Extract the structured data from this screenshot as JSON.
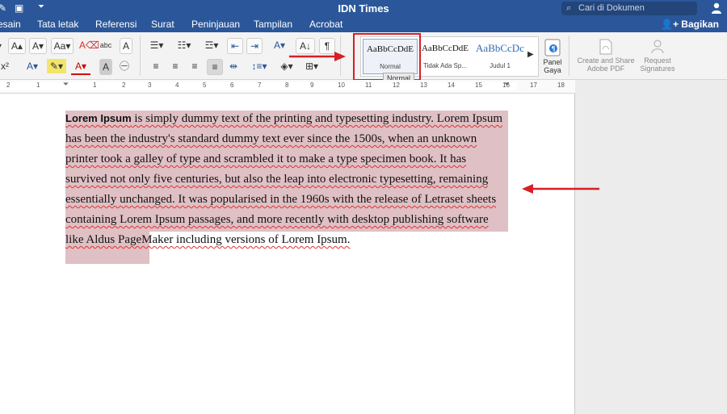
{
  "app": {
    "title": "IDN Times"
  },
  "search": {
    "placeholder": "Cari di Dokumen"
  },
  "tabs": [
    "esain",
    "Tata letak",
    "Referensi",
    "Surat",
    "Peninjauan",
    "Tampilan",
    "Acrobat"
  ],
  "share_label": "Bagikan",
  "styles": [
    {
      "sample": "AaBbCcDdE",
      "name": "Normal"
    },
    {
      "sample": "AaBbCcDdE",
      "name": "Tidak Ada Sp..."
    },
    {
      "sample": "AaBbCcDc",
      "name": "Judul 1"
    }
  ],
  "tooltip": "Normal",
  "panel": {
    "line1": "Panel",
    "line2": "Gaya"
  },
  "create_share": {
    "line1": "Create and Share",
    "line2": "Adobe PDF"
  },
  "request_sig": {
    "line1": "Request",
    "line2": "Signatures"
  },
  "ruler_numbers": [
    "2",
    "1",
    "1",
    "2",
    "3",
    "4",
    "5",
    "6",
    "7",
    "8",
    "9",
    "10",
    "11",
    "12",
    "13",
    "14",
    "15",
    "16",
    "17",
    "18"
  ],
  "document": {
    "bold_start": "Lorem Ipsum",
    "paragraph": " is simply dummy text of the printing and typesetting industry. Lorem Ipsum has been the industry's standard dummy text ever since the 1500s, when an unknown printer took a galley of type and scrambled it to make a type specimen book. It has survived not only five centuries, but also the leap into electronic typesetting, remaining essentially unchanged. It was popularised in the 1960s with the release of Letraset sheets containing Lorem Ipsum passages, and more recently with desktop publishing software like Aldus PageMaker including versions of Lorem Ipsum."
  },
  "colors": {
    "title_bar": "#2b579a",
    "highlight": "#dfc0c4",
    "annotation": "#d61f26"
  }
}
